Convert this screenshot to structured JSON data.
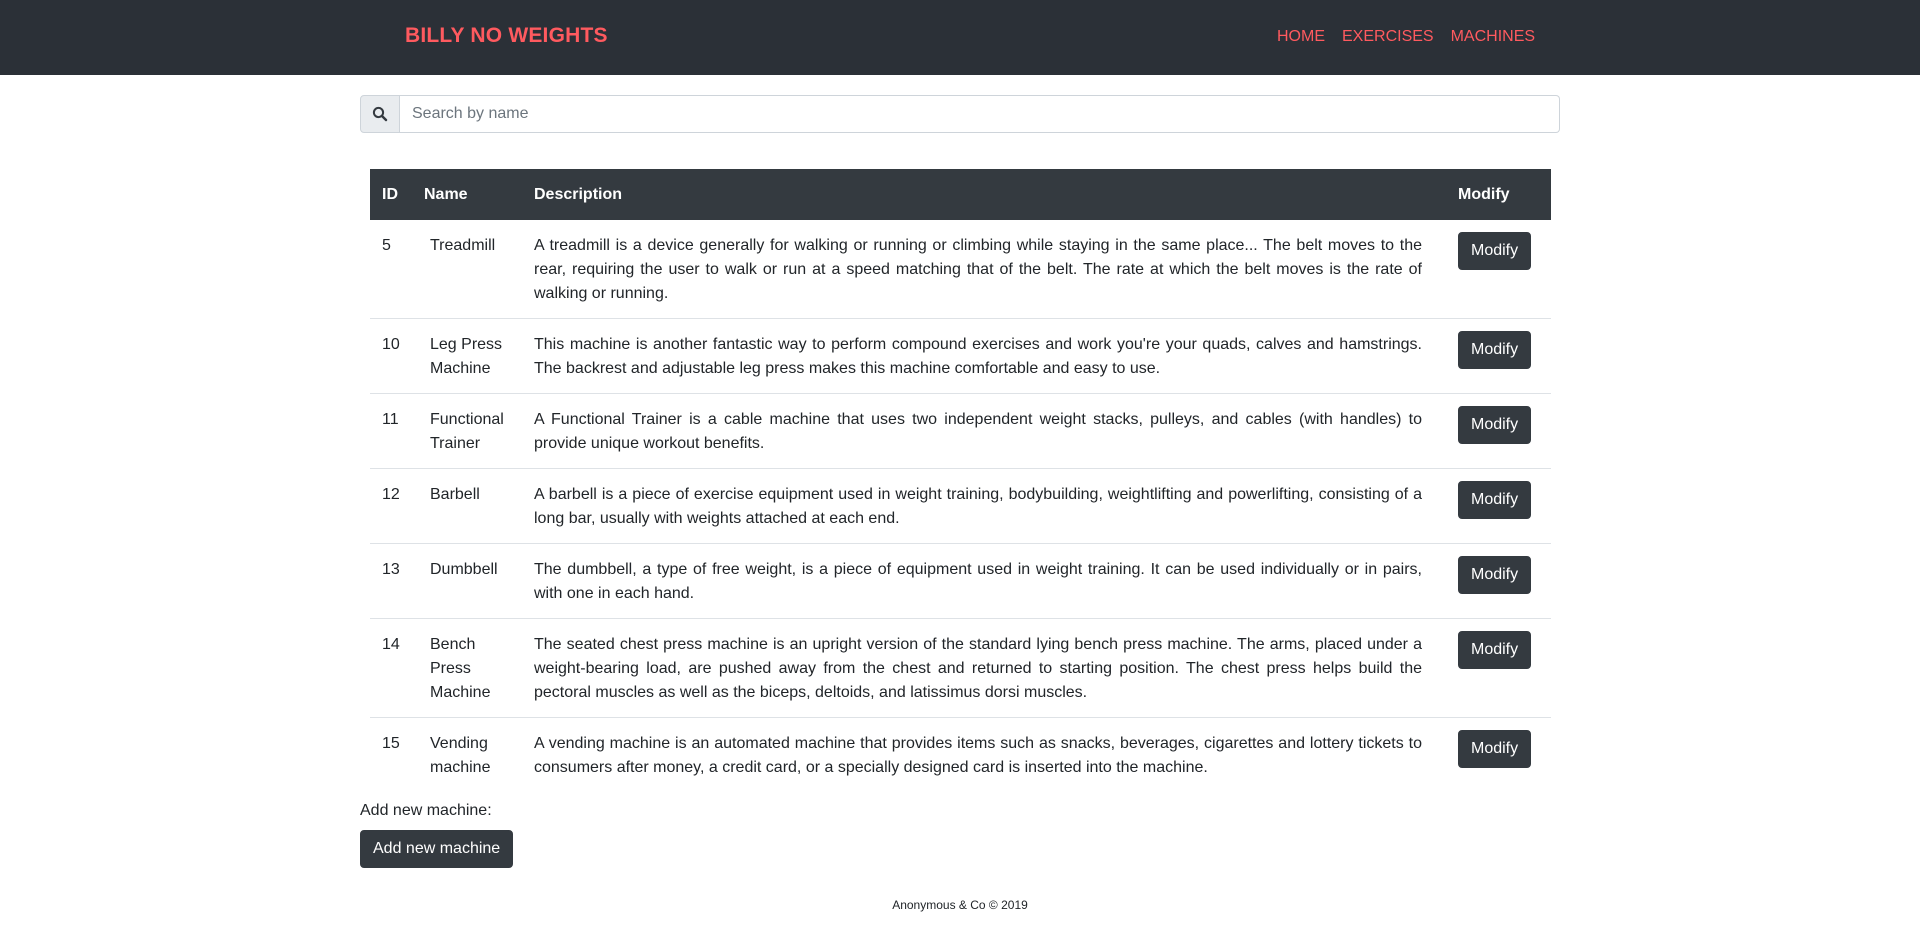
{
  "navbar": {
    "brand": "BILLY NO WEIGHTS",
    "links": [
      "HOME",
      "EXERCISES",
      "MACHINES"
    ],
    "accent_color": "#ff5a5f",
    "background_color": "#2b3037"
  },
  "search": {
    "icon": "search-icon",
    "placeholder": "Search by name",
    "value": ""
  },
  "table": {
    "headers": {
      "id": "ID",
      "name": "Name",
      "description": "Description",
      "modify": "Modify"
    },
    "rows": [
      {
        "id": "5",
        "name": "Treadmill",
        "description": "A treadmill is a device generally for walking or running or climbing while staying in the same place... The belt moves to the rear, requiring the user to walk or run at a speed matching that of the belt. The rate at which the belt moves is the rate of walking or running.",
        "button": "Modify"
      },
      {
        "id": "10",
        "name": "Leg Press Machine",
        "description": "This machine is another fantastic way to perform compound exercises and work you're your quads, calves and hamstrings. The backrest and adjustable leg press makes this machine comfortable and easy to use.",
        "button": "Modify"
      },
      {
        "id": "11",
        "name": "Functional Trainer",
        "description": "A Functional Trainer is a cable machine that uses two independent weight stacks, pulleys, and cables (with handles) to provide unique workout benefits.",
        "button": "Modify"
      },
      {
        "id": "12",
        "name": "Barbell",
        "description": "A barbell is a piece of exercise equipment used in weight training, bodybuilding, weightlifting and powerlifting, consisting of a long bar, usually with weights attached at each end.",
        "button": "Modify"
      },
      {
        "id": "13",
        "name": "Dumbbell",
        "description": "The dumbbell, a type of free weight, is a piece of equipment used in weight training. It can be used individually or in pairs, with one in each hand.",
        "button": "Modify"
      },
      {
        "id": "14",
        "name": "Bench Press Machine",
        "description": "The seated chest press machine is an upright version of the standard lying bench press machine. The arms, placed under a weight-bearing load, are pushed away from the chest and returned to starting position. The chest press helps build the pectoral muscles as well as the biceps, deltoids, and latissimus dorsi muscles.",
        "button": "Modify"
      },
      {
        "id": "15",
        "name": "Vending machine",
        "description": "A vending machine is an automated machine that provides items such as snacks, beverages, cigarettes and lottery tickets to consumers after money, a credit card, or a specially designed card is inserted into the machine.",
        "button": "Modify"
      }
    ]
  },
  "add_section": {
    "label": "Add new machine:",
    "button": "Add new machine"
  },
  "footer": {
    "text": "Anonymous & Co © 2019"
  }
}
